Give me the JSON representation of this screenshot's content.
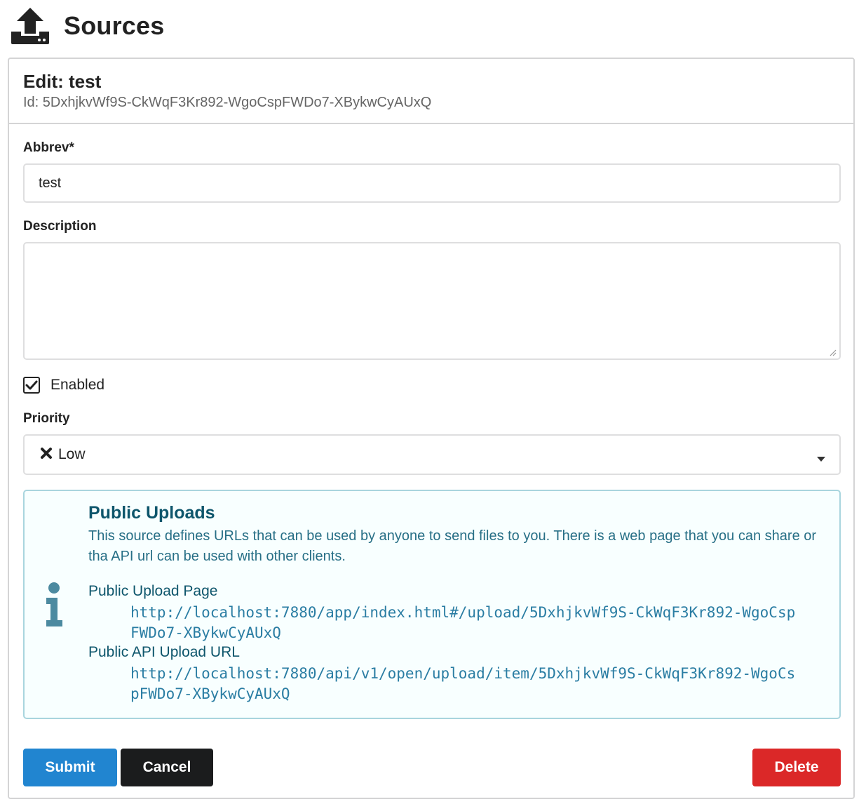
{
  "header": {
    "title": "Sources",
    "icon": "upload-icon"
  },
  "form": {
    "edit_title": "Edit: test",
    "id_line": "Id: 5DxhjkvWf9S-CkWqF3Kr892-WgoCspFWDo7-XBykwCyAUxQ",
    "abbrev": {
      "label": "Abbrev*",
      "value": "test"
    },
    "description": {
      "label": "Description",
      "value": ""
    },
    "enabled": {
      "label": "Enabled",
      "checked": true
    },
    "priority": {
      "label": "Priority",
      "selected": "Low",
      "icon": "x-icon"
    }
  },
  "info": {
    "icon": "info-icon",
    "header": "Public Uploads",
    "text": "This source defines URLs that can be used by anyone to send files to you. There is a web page that you can share or tha API url can be used with other clients.",
    "upload_page_label": "Public Upload Page",
    "upload_page_url": "http://localhost:7880/app/index.html#/upload/5DxhjkvWf9S-CkWqF3Kr892-WgoCspFWDo7-XBykwCyAUxQ",
    "api_url_label": "Public API Upload URL",
    "api_url": "http://localhost:7880/api/v1/open/upload/item/5DxhjkvWf9S-CkWqF3Kr892-WgoCspFWDo7-XBykwCyAUxQ"
  },
  "buttons": {
    "submit": "Submit",
    "cancel": "Cancel",
    "delete": "Delete"
  },
  "colors": {
    "submit": "#2185d0",
    "cancel": "#1b1c1d",
    "delete": "#db2828",
    "info_header": "#0e566c",
    "info_text": "#276f86",
    "info_background": "#f8ffff",
    "info_border": "#a9d5de"
  }
}
